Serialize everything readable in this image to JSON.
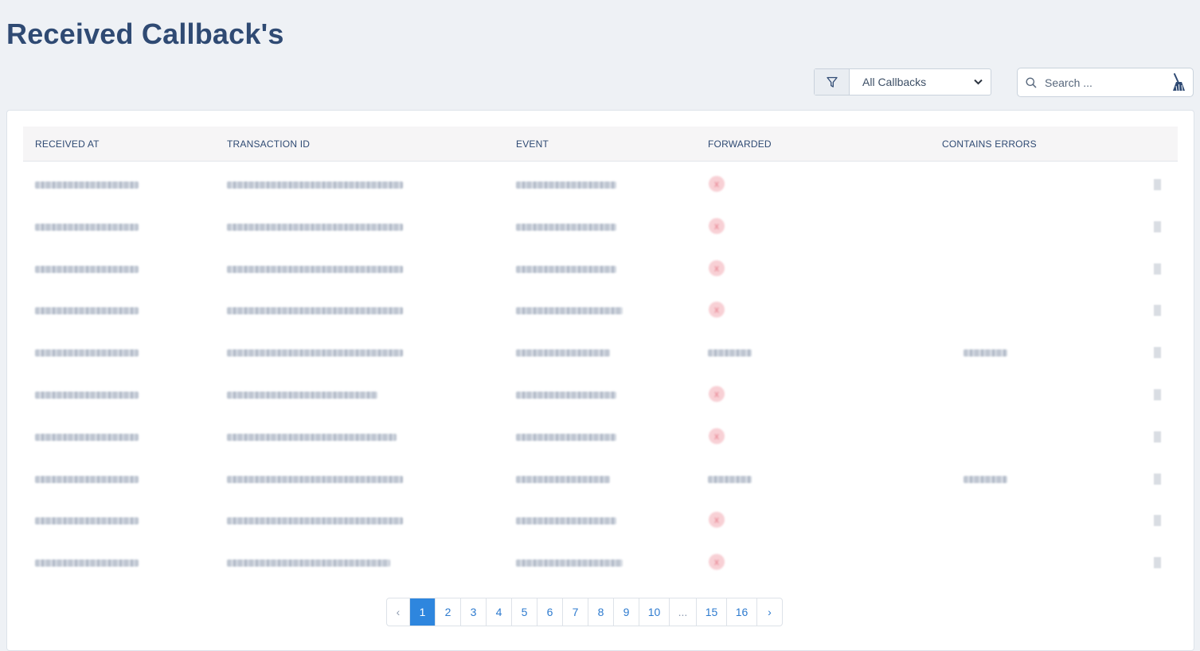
{
  "page": {
    "title": "Received Callback's"
  },
  "toolbar": {
    "filter_icon": "funnel-icon",
    "filter_value": "All Callbacks",
    "search_placeholder": "Search ...",
    "clear_icon": "broom-icon"
  },
  "table": {
    "columns": [
      "RECEIVED AT",
      "TRANSACTION ID",
      "EVENT",
      "FORWARDED",
      "CONTAINS ERRORS"
    ],
    "rows": [
      {
        "received_at": "2023-02-24 03:18:58",
        "transaction_id": "h_aP0f5y8q0p6Huyy5mKNwqv4A3",
        "event": "DOCUMENT_SIGNED",
        "forwarded": "x",
        "contains_errors": ""
      },
      {
        "received_at": "2023-02-24 03:18:27",
        "transaction_id": "h_aP0f5y8q0p6Huyy5mKNwqv4A3",
        "event": "SIGNER_COMPLETE",
        "forwarded": "x",
        "contains_errors": ""
      },
      {
        "received_at": "2023-02-24 03:18:07",
        "transaction_id": "h_aP0f5y8q0p6Huyy5mKNwqv4A3",
        "event": "DOCUMENT_SIGNED",
        "forwarded": "x",
        "contains_errors": ""
      },
      {
        "received_at": "2023-02-24 03:18:08",
        "transaction_id": "h_aP0f5y8q0p6Huyy5mKNwqv4A3",
        "event": "PACKAGE_ACTIVATE",
        "forwarded": "x",
        "contains_errors": ""
      },
      {
        "received_at": "2023-02-24 03:18:05",
        "transaction_id": "h_aP0f5y8q0p6Huyy5mKNwqv4A3",
        "event": "PACKAGE_CREATE",
        "forwarded": "Test 531",
        "contains_errors": "Test 531"
      },
      {
        "received_at": "2023-02-24 03:17:58",
        "transaction_id": "m5DDkRnkxJTmpMmn5TPkqc3",
        "event": "TEMPLATE_CREATE",
        "forwarded": "x",
        "contains_errors": ""
      },
      {
        "received_at": "2023-02-24 03:15:59",
        "transaction_id": "yjv8Bkkrya2RDVM8p8HXTK4_TA",
        "event": "TEMPLATE_CREATE",
        "forwarded": "x",
        "contains_errors": ""
      },
      {
        "received_at": "2023-02-24 03:13:58",
        "transaction_id": "mh_lCu8Ox6NTAcKgBPHEDenus32",
        "event": "PACKAGE_CREATE",
        "forwarded": "Test 531",
        "contains_errors": "Test 531"
      },
      {
        "received_at": "2023-02-24 03:12:59",
        "transaction_id": "6_7X0Y4NZAEL_aCuSn5hQNG8Mkd",
        "event": "TEMPLATE_CREATE",
        "forwarded": "x",
        "contains_errors": ""
      },
      {
        "received_at": "2023-02-24 03:07:58",
        "transaction_id": "bbNNqkpbOM8NM2N7B3R_TU7b4",
        "event": "PACKAGE_COMPLETE",
        "forwarded": "x",
        "contains_errors": ""
      }
    ]
  },
  "pagination": {
    "prev": "‹",
    "pages": [
      "1",
      "2",
      "3",
      "4",
      "5",
      "6",
      "7",
      "8",
      "9",
      "10",
      "...",
      "15",
      "16"
    ],
    "next": "›",
    "current": "1"
  }
}
